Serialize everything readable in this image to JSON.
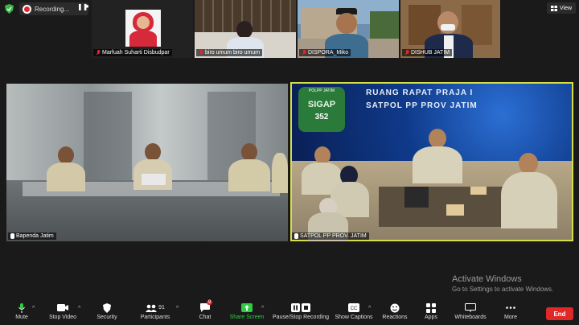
{
  "topbar": {
    "recording_label": "Recording...",
    "pause_icon": "pause-icon",
    "stop_icon": "stop-icon",
    "view_label": "View"
  },
  "participants": [
    {
      "name": "Marfuah Suharti Disbudpar"
    },
    {
      "name": "biro umum biro umum"
    },
    {
      "name": "DISPORA_Miko"
    },
    {
      "name": "DISHUB JATIM"
    }
  ],
  "main_tiles": [
    {
      "name": "Bapenda Jatim"
    },
    {
      "name": "SATPOL PP PROV. JATIM"
    }
  ],
  "banner": {
    "line1": "RUANG RAPAT PRAJA I",
    "line2": "SATPOL PP PROV JATIM",
    "logo_text": "SIGAP",
    "logo_number": "352",
    "logo_top": "POLPP JATIM"
  },
  "toolbar": {
    "mute": "Mute",
    "stop_video": "Stop Video",
    "security": "Security",
    "participants": "Participants",
    "participants_count": "91",
    "chat": "Chat",
    "chat_badge": "9",
    "share_screen": "Share Screen",
    "record": "Pause/Stop Recording",
    "captions": "Show Captions",
    "reactions": "Reactions",
    "apps": "Apps",
    "whiteboards": "Whiteboards",
    "more": "More",
    "end": "End"
  },
  "watermark": {
    "title": "Activate Windows",
    "subtitle": "Go to Settings to activate Windows."
  },
  "colors": {
    "active_speaker": "#d4e04a",
    "end": "#e02828",
    "share": "#2ecc40",
    "banner_bg": "#0b2a6e"
  }
}
